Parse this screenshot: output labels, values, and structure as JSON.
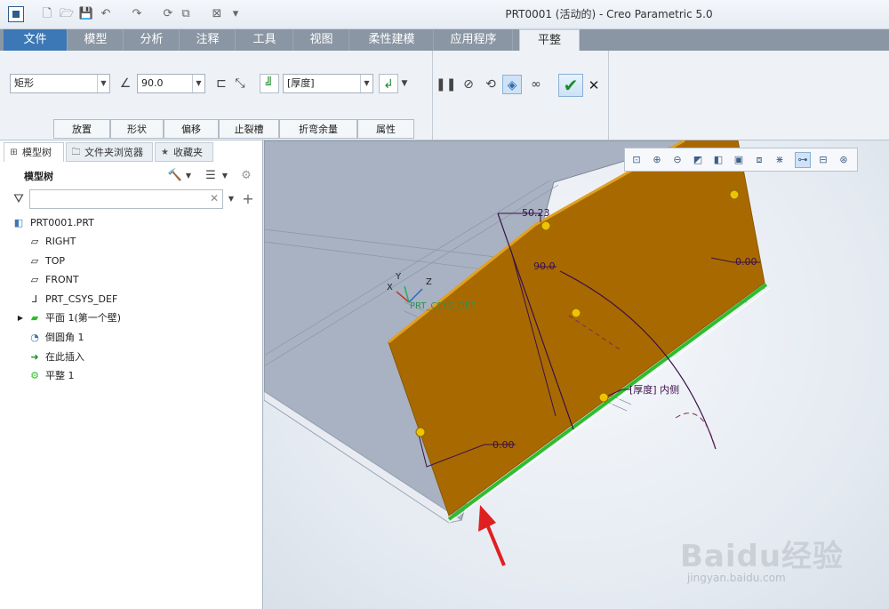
{
  "window": {
    "title": "PRT0001 (活动的) - Creo Parametric 5.0"
  },
  "tabs": [
    {
      "label": "文件"
    },
    {
      "label": "模型"
    },
    {
      "label": "分析"
    },
    {
      "label": "注释"
    },
    {
      "label": "工具"
    },
    {
      "label": "视图"
    },
    {
      "label": "柔性建模"
    },
    {
      "label": "应用程序"
    },
    {
      "label": "平整"
    }
  ],
  "ribbon": {
    "shape_select": "矩形",
    "angle_value": "90.0",
    "thickness_select": "[厚度]",
    "slideup_tabs": [
      "放置",
      "形状",
      "偏移",
      "止裂槽",
      "折弯余量",
      "属性"
    ]
  },
  "model_tree": {
    "tabs": [
      "模型树",
      "文件夹浏览器",
      "收藏夹"
    ],
    "title": "模型树",
    "items": [
      {
        "label": "PRT0001.PRT",
        "icon": "part-icon"
      },
      {
        "label": "RIGHT",
        "icon": "datum-plane-icon"
      },
      {
        "label": "TOP",
        "icon": "datum-plane-icon"
      },
      {
        "label": "FRONT",
        "icon": "datum-plane-icon"
      },
      {
        "label": "PRT_CSYS_DEF",
        "icon": "csys-icon"
      },
      {
        "label": "平面 1(第一个壁)",
        "icon": "planar-wall-icon"
      },
      {
        "label": "倒圆角 1",
        "icon": "round-icon"
      },
      {
        "label": "在此插入",
        "icon": "insert-here-arrow-icon"
      },
      {
        "label": "平整 1",
        "icon": "flat-wall-icon"
      }
    ]
  },
  "viewport": {
    "dim_length": "50.23",
    "dim_angle": "90.0",
    "dim_offset_right": "0.00",
    "dim_offset_left": "0.00",
    "thickness_label": "[厚度]",
    "side_label": "内侧",
    "csys_label": "PRT_CSYS_DEF",
    "axis_x": "X",
    "axis_y": "Y",
    "axis_z": "Z"
  },
  "watermark": {
    "text": "Baidu经验",
    "url": "jingyan.baidu.com"
  },
  "colors": {
    "flange": "#a86a00",
    "base": "#a8b2c2",
    "accent": "#3d78b6",
    "edge": "#2ebd2e"
  }
}
